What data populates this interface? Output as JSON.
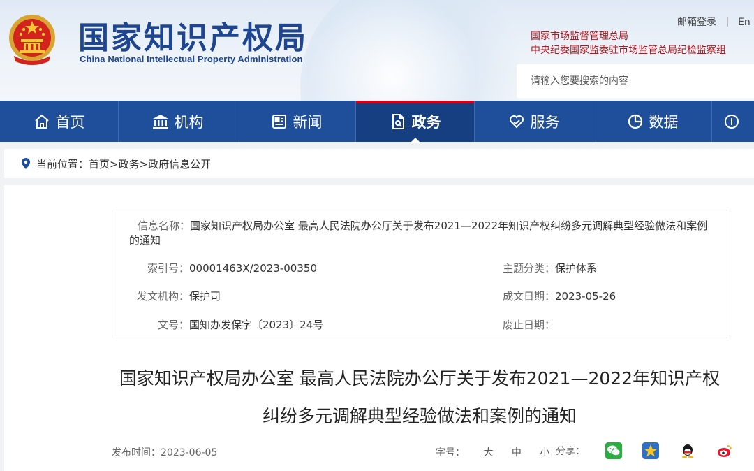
{
  "header": {
    "logo_cn": "国家知识产权局",
    "logo_en": "China National Intellectual Property Administration",
    "top_links": [
      "邮箱登录",
      "En"
    ],
    "org_links": [
      "国家市场监督管理总局",
      "中央纪委国家监委驻市场监管总局纪检监察组"
    ],
    "search_placeholder": "请输入您要搜索的内容"
  },
  "nav": {
    "items": [
      {
        "label": "首页",
        "icon": "home-icon"
      },
      {
        "label": "机构",
        "icon": "institution-icon"
      },
      {
        "label": "新闻",
        "icon": "news-icon"
      },
      {
        "label": "政务",
        "icon": "document-icon",
        "active": true
      },
      {
        "label": "服务",
        "icon": "heart-hand-icon"
      },
      {
        "label": "数据",
        "icon": "pie-chart-icon"
      }
    ]
  },
  "breadcrumb": {
    "prefix": "当前位置：",
    "items": [
      "首页",
      ">",
      "政务",
      ">",
      "政府信息公开"
    ]
  },
  "info_table": {
    "name_label": "信息名称：",
    "name_value": "国家知识产权局办公室 最高人民法院办公厅关于发布2021—2022年知识产权纠纷多元调解典型经验做法和案例的通知",
    "index_label": "索引号：",
    "index_value": "00001463X/2023-00350",
    "topic_label": "主题分类：",
    "topic_value": "保护体系",
    "issuer_label": "发文机构：",
    "issuer_value": "保护司",
    "date_label": "成文日期：",
    "date_value": "2023-05-26",
    "docno_label": "文号：",
    "docno_value": "国知办发保字〔2023〕24号",
    "expire_label": "废止日期：",
    "expire_value": ""
  },
  "article": {
    "title_line1": "国家知识产权局办公室 最高人民法院办公厅关于发布2021—2022年知识产权",
    "title_line2": "纠纷多元调解典型经验做法和案例的通知",
    "publish_label": "发布时间：",
    "publish_date": "2023-06-05",
    "fontsize_label": "字号：",
    "fontsize_options": [
      "大",
      "中",
      "小"
    ],
    "share_label": "分享：",
    "share_icons": [
      "wechat-icon",
      "favorite-star-icon",
      "qq-icon",
      "weibo-icon"
    ]
  },
  "colors": {
    "nav_bg": "#1f4e9a",
    "nav_active": "#163f82",
    "accent_red": "#d0021b",
    "logo_blue": "#1d4590",
    "org_red": "#b5161b"
  }
}
